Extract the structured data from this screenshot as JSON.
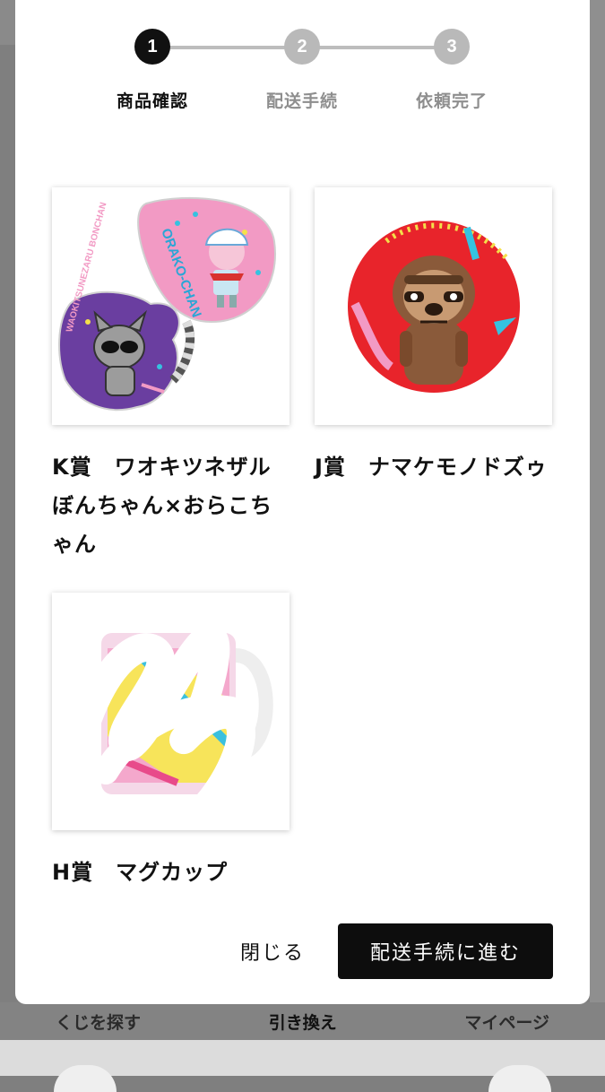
{
  "background_nav": {
    "items": [
      "くじを探す",
      "引き換え",
      "マイページ"
    ],
    "active_index": 1
  },
  "stepper": {
    "steps": [
      {
        "number": "1",
        "label": "商品確認",
        "active": true
      },
      {
        "number": "2",
        "label": "配送手続",
        "active": false
      },
      {
        "number": "3",
        "label": "依頼完了",
        "active": false
      }
    ]
  },
  "prizes": [
    {
      "title": "K賞　ワオキツネザルぼんちゃん×おらこちゃん",
      "image": "acrylic-stickers-image",
      "image_text": [
        "ORAKO-CHAN",
        "WAOKITSUNEZARU BONCHAN"
      ]
    },
    {
      "title": "J賞　ナマケモノドズゥ",
      "image": "sloth-can-badge-image"
    },
    {
      "title": "H賞　マグカップ",
      "image": "mug-cup-image"
    }
  ],
  "footer": {
    "close_label": "閉じる",
    "proceed_label": "配送手続に進む"
  },
  "colors": {
    "accent": "#0d0d0d",
    "inactive_step": "#b9b9b9",
    "modal_bg": "#ffffff",
    "overlay": "#7f7f7f"
  }
}
